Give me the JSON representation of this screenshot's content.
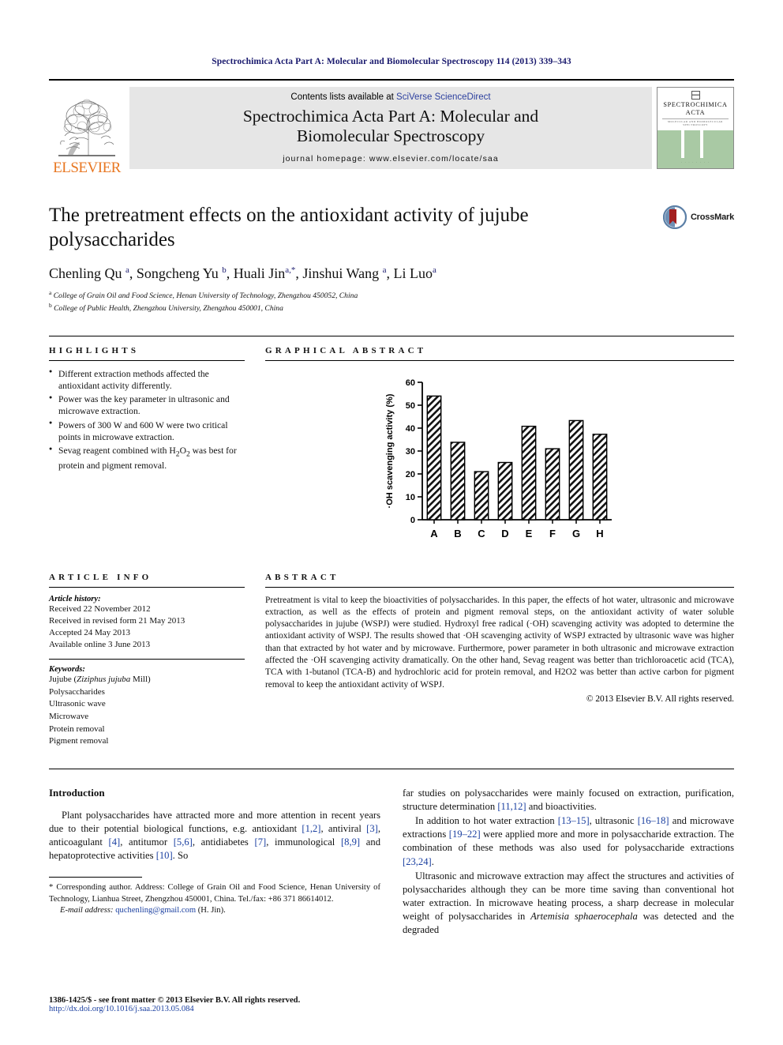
{
  "running_head": "Spectrochimica Acta Part A: Molecular and Biomolecular Spectroscopy 114 (2013) 339–343",
  "masthead": {
    "contents_prefix": "Contents lists available at ",
    "sciencedirect": "SciVerse ScienceDirect",
    "journal_title_line1": "Spectrochimica Acta Part A: Molecular and",
    "journal_title_line2": "Biomolecular Spectroscopy",
    "homepage": "journal homepage: www.elsevier.com/locate/saa",
    "publisher": "ELSEVIER",
    "cover_title_line1": "SPECTROCHIMICA",
    "cover_title_line2": "ACTA",
    "cover_sub": "MOLECULAR AND BIOMOLECULAR SPECTROSCOPY",
    "cover_dots": "· · · · · · · ·"
  },
  "article": {
    "title": "The pretreatment effects on the antioxidant activity of jujube polysaccharides",
    "authors": "Chenling Qu a, Songcheng Yu b, Huali Jin a,*, Jinshui Wang a, Li Luo a",
    "affiliation_a": "College of Grain Oil and Food Science, Henan University of Technology, Zhengzhou 450052, China",
    "affiliation_b": "College of Public Health, Zhengzhou University, Zhengzhou 450001, China",
    "crossmark_label": "CrossMark"
  },
  "sections": {
    "highlights_head": "HIGHLIGHTS",
    "graphical_abstract_head": "GRAPHICAL ABSTRACT",
    "article_info_head": "ARTICLE INFO",
    "abstract_head": "ABSTRACT"
  },
  "highlights": [
    "Different extraction methods affected the antioxidant activity differently.",
    "Power was the key parameter in ultrasonic and microwave extraction.",
    "Powers of 300 W and 600 W were two critical points in microwave extraction.",
    "Sevag reagent combined with H2O2 was best for protein and pigment removal."
  ],
  "article_info": {
    "history_label": "Article history:",
    "history": [
      "Received 22 November 2012",
      "Received in revised form 21 May 2013",
      "Accepted 24 May 2013",
      "Available online 3 June 2013"
    ],
    "keywords_label": "Keywords:",
    "keywords": [
      "Jujube (Ziziphus jujuba Mill)",
      "Polysaccharides",
      "Ultrasonic wave",
      "Microwave",
      "Protein removal",
      "Pigment removal"
    ]
  },
  "abstract": {
    "text": "Pretreatment is vital to keep the bioactivities of polysaccharides. In this paper, the effects of hot water, ultrasonic and microwave extraction, as well as the effects of protein and pigment removal steps, on the antioxidant activity of water soluble polysaccharides in jujube (WSPJ) were studied. Hydroxyl free radical (·OH) scavenging activity was adopted to determine the antioxidant activity of WSPJ. The results showed that ·OH scavenging activity of WSPJ extracted by ultrasonic wave was higher than that extracted by hot water and by microwave. Furthermore, power parameter in both ultrasonic and microwave extraction affected the ·OH scavenging activity dramatically. On the other hand, Sevag reagent was better than trichloroacetic acid (TCA), TCA with 1-butanol (TCA-B) and hydrochloric acid for protein removal, and H2O2 was better than active carbon for pigment removal to keep the antioxidant activity of WSPJ.",
    "copyright": "© 2013 Elsevier B.V. All rights reserved."
  },
  "chart_data": {
    "type": "bar",
    "title": "",
    "xlabel": "",
    "ylabel": "·OH scavenging activity (%)",
    "categories": [
      "A",
      "B",
      "C",
      "D",
      "E",
      "F",
      "G",
      "H"
    ],
    "values": [
      54.0,
      33.8,
      21.0,
      25.0,
      40.8,
      31.0,
      43.3,
      37.3
    ],
    "ylim": [
      0,
      60
    ],
    "yticks": [
      0,
      10,
      20,
      30,
      40,
      50,
      60
    ],
    "grid": false,
    "legend": "none",
    "bar_fill": "hatched-diagonal"
  },
  "body": {
    "intro_head": "Introduction",
    "left_paragraph": "Plant polysaccharides have attracted more and more attention in recent years due to their potential biological functions, e.g. antioxidant [1,2], antiviral [3], anticoagulant [4], antitumor [5,6], antidiabetes [7], immunological [8,9] and hepatoprotective activities [10]. So",
    "right_paragraph_1": "far studies on polysaccharides were mainly focused on extraction, purification, structure determination [11,12] and bioactivities.",
    "right_paragraph_2": "In addition to hot water extraction [13–15], ultrasonic [16–18] and microwave extractions [19–22] were applied more and more in polysaccharide extraction. The combination of these methods was also used for polysaccharide extractions [23,24].",
    "right_paragraph_3": "Ultrasonic and microwave extraction may affect the structures and activities of polysaccharides although they can be more time saving than conventional hot water extraction. In microwave heating process, a sharp decrease in molecular weight of polysaccharides in Artemisia sphaerocephala was detected and the degraded"
  },
  "footnote": {
    "corresponding": "* Corresponding author. Address: College of Grain Oil and Food Science, Henan University of Technology, Lianhua Street, Zhengzhou 450001, China. Tel./fax: +86 371 86614012.",
    "email_label": "E-mail address:",
    "email": "quchenling@gmail.com",
    "email_suffix": "(H. Jin)."
  },
  "footer": {
    "issn": "1386-1425/$ - see front matter © 2013 Elsevier B.V. All rights reserved.",
    "doi": "http://dx.doi.org/10.1016/j.saa.2013.05.084"
  }
}
